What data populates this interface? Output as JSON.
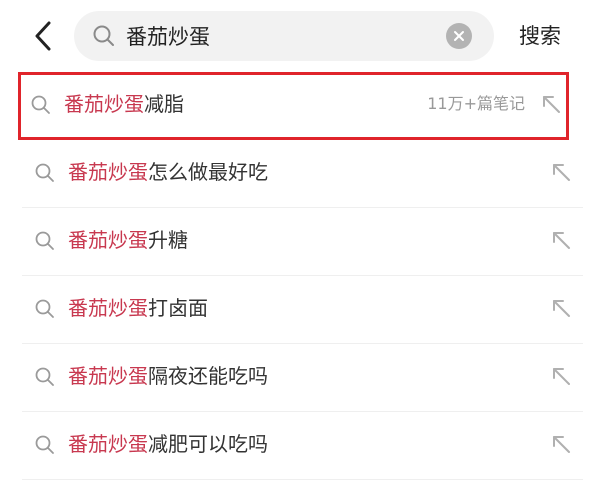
{
  "search": {
    "value": "番茄炒蛋",
    "button_label": "搜索"
  },
  "icons": {
    "back": "chevron-left-icon",
    "search": "search-icon",
    "clear": "clear-icon",
    "fill": "arrow-up-left-icon"
  },
  "colors": {
    "keyword": "#c8384f",
    "highlight_box": "#e0242b",
    "text": "#333333",
    "muted": "#999999"
  },
  "suggestions": [
    {
      "keyword": "番茄炒蛋",
      "rest": "减脂",
      "count": "11万+篇笔记",
      "highlighted": true
    },
    {
      "keyword": "番茄炒蛋",
      "rest": "怎么做最好吃",
      "count": ""
    },
    {
      "keyword": "番茄炒蛋",
      "rest": "升糖",
      "count": ""
    },
    {
      "keyword": "番茄炒蛋",
      "rest": "打卤面",
      "count": ""
    },
    {
      "keyword": "番茄炒蛋",
      "rest": "隔夜还能吃吗",
      "count": ""
    },
    {
      "keyword": "番茄炒蛋",
      "rest": "减肥可以吃吗",
      "count": ""
    }
  ]
}
